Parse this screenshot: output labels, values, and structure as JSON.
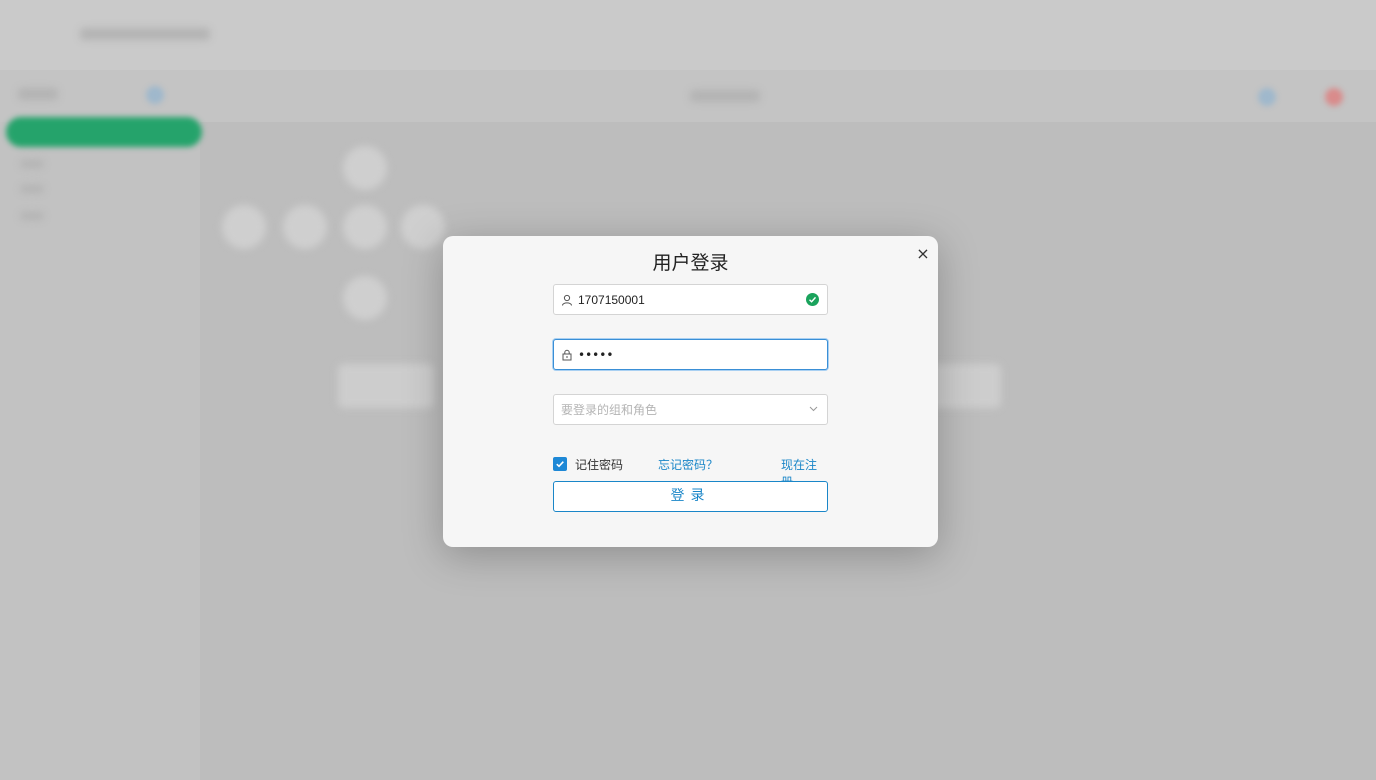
{
  "dialog": {
    "title": "用户登录",
    "close_glyph": "×",
    "username": {
      "value": "1707150001",
      "icon": "user-icon",
      "valid": true
    },
    "password": {
      "value": "•••••",
      "icon": "lock-icon"
    },
    "role_select": {
      "placeholder": "要登录的组和角色",
      "icon": "chevron-down-icon"
    },
    "remember": {
      "label": "记住密码",
      "checked": true
    },
    "forgot_link": "忘记密码？",
    "register_link": "现在注册",
    "login_button": "登录"
  },
  "colors": {
    "accent": "#1a86c8",
    "success": "#1aa35c",
    "sidebar_active": "#25a36b"
  }
}
